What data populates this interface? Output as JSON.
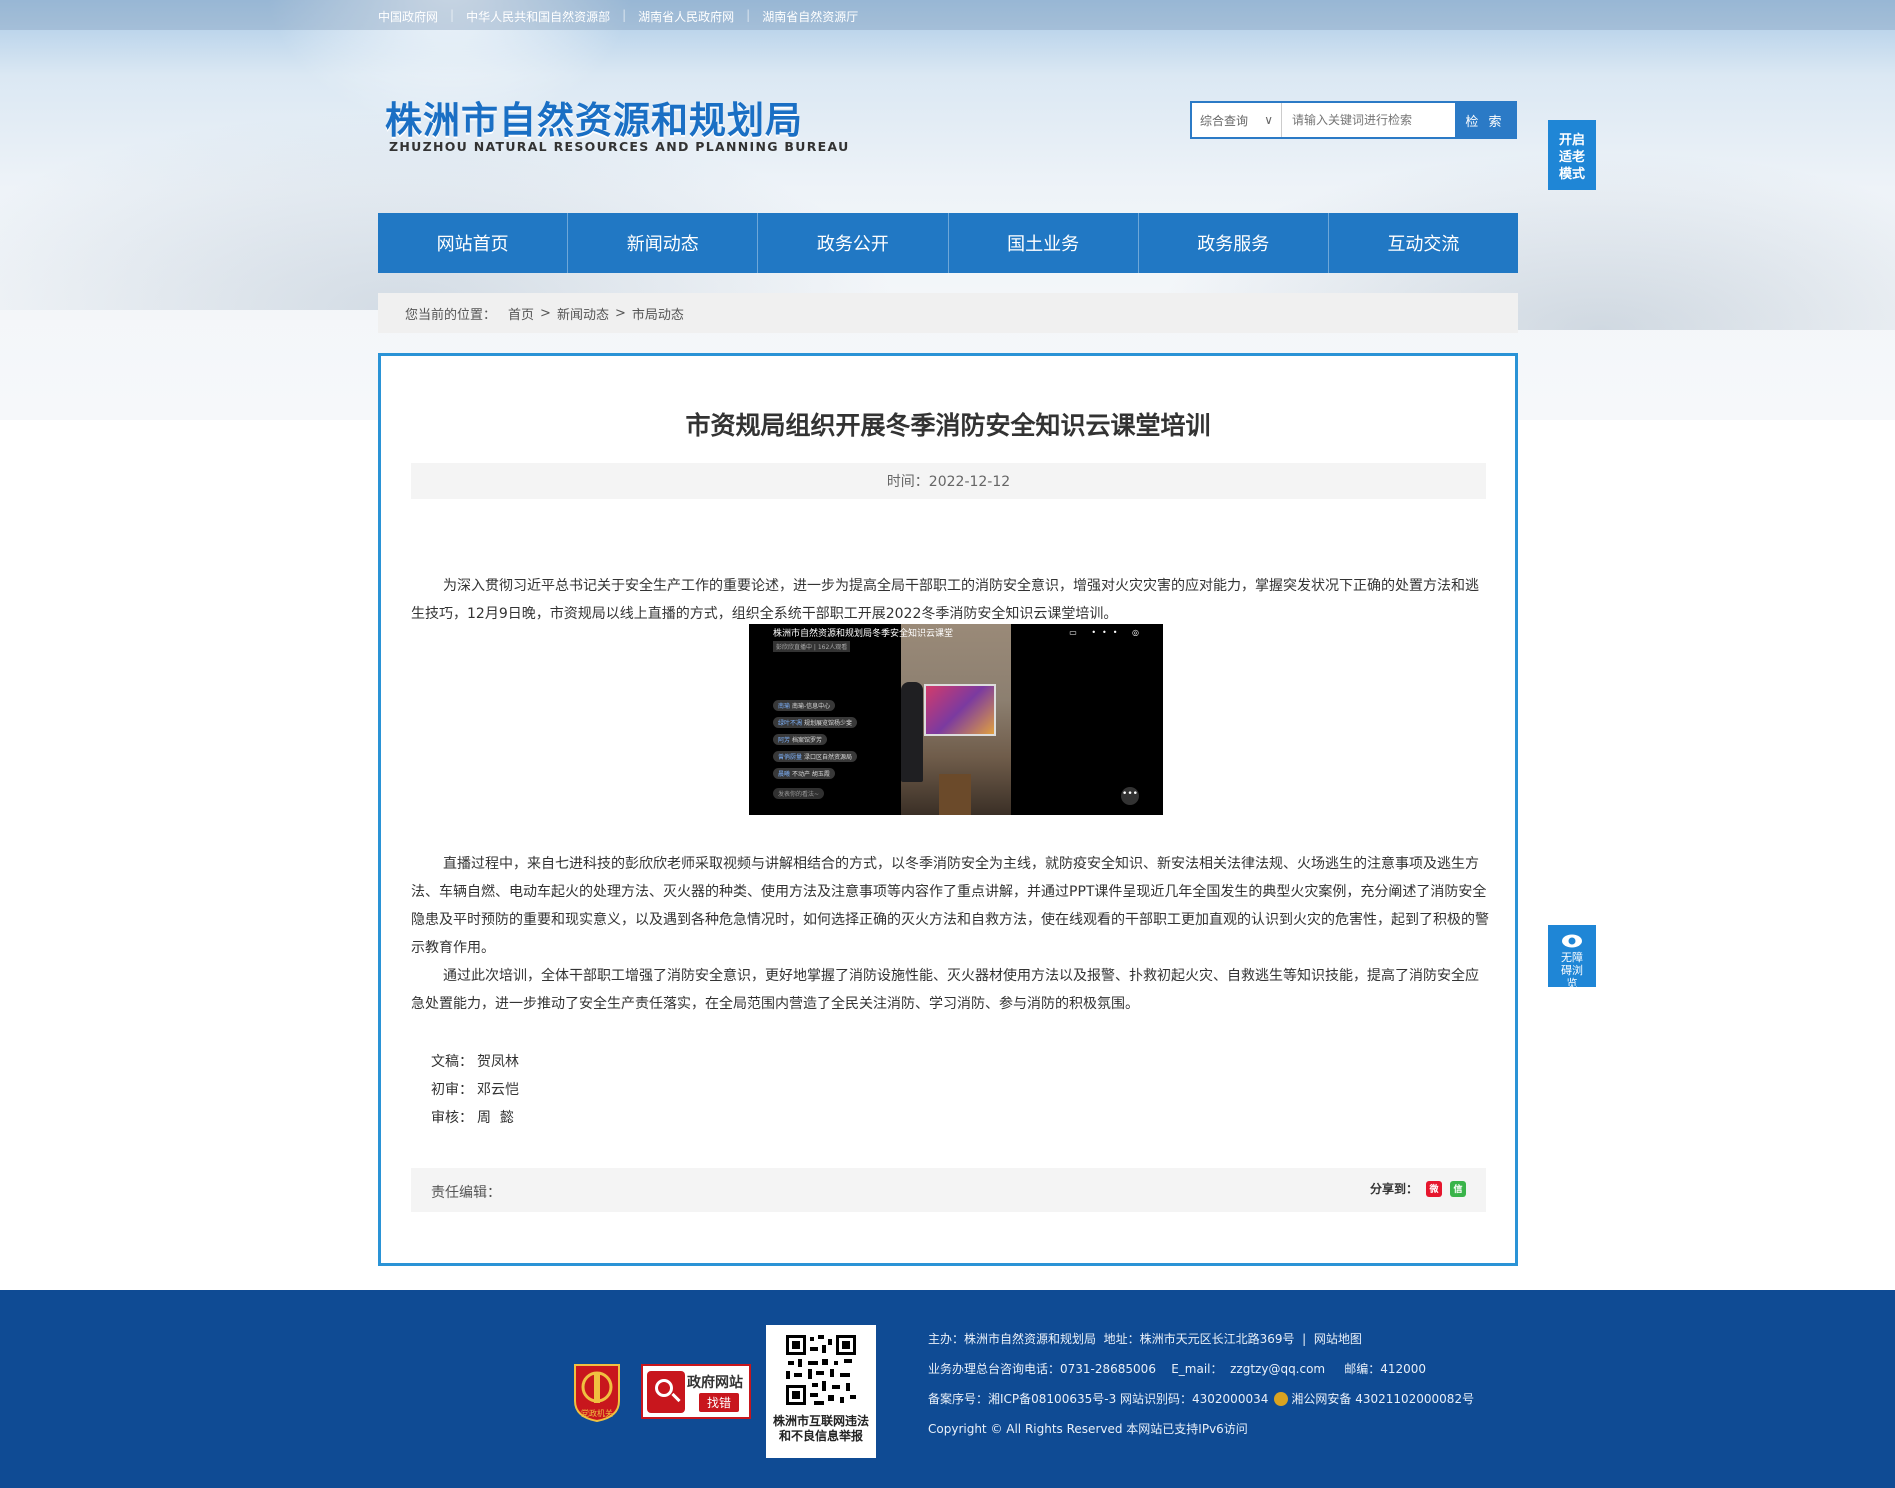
{
  "toplinks": [
    "中国政府网",
    "中华人民共和国自然资源部",
    "湖南省人民政府网",
    "湖南省自然资源厅"
  ],
  "logo": {
    "cn": "株洲市自然资源和规划局",
    "en": "ZHUZHOU NATURAL RESOURCES AND PLANNING BUREAU"
  },
  "search": {
    "select_value": "综合查询",
    "placeholder": "请输入关键词进行检索",
    "button": "检 索"
  },
  "side": {
    "elder_mode": "开启适老模式",
    "accessibility": "无障碍浏览"
  },
  "nav": [
    "网站首页",
    "新闻动态",
    "政务公开",
    "国土业务",
    "政务服务",
    "互动交流"
  ],
  "breadcrumb": {
    "prefix": "您当前的位置：",
    "items": [
      "首页",
      ">",
      "新闻动态",
      ">",
      "市局动态"
    ]
  },
  "article": {
    "title": "市资规局组织开展冬季消防安全知识云课堂培训",
    "date": "时间：2022-12-12",
    "paragraphs": [
      "为深入贯彻习近平总书记关于安全生产工作的重要论述，进一步为提高全局干部职工的消防安全意识，增强对火灾灾害的应对能力，掌握突发状况下正确的处置方法和逃生技巧，12月9日晚，市资规局以线上直播的方式，组织全系统干部职工开展2022冬季消防安全知识云课堂培训。",
      "直播过程中，来自七进科技的彭欣欣老师采取视频与讲解相结合的方式，以冬季消防安全为主线，就防疫安全知识、新安法相关法律法规、火场逃生的注意事项及逃生方法、车辆自燃、电动车起火的处理方法、灭火器的种类、使用方法及注意事项等内容作了重点讲解，并通过PPT课件呈现近几年全国发生的典型火灾案例，充分阐述了消防安全隐患及平时预防的重要和现实意义，以及遇到各种危急情况时，如何选择正确的灭火方法和自救方法，使在线观看的干部职工更加直观的认识到火灾的危害性，起到了积极的警示教育作用。",
      "通过此次培训，全体干部职工增强了消防安全意识，更好地掌握了消防设施性能、灭火器材使用方法以及报警、扑救初起火灾、自救逃生等知识技能，提高了消防安全应急处置能力，进一步推动了安全生产责任落实，在全局范围内营造了全民关注消防、学习消防、参与消防的积极氛围。"
    ],
    "video": {
      "title": "株洲市自然资源和规划局冬季安全知识云课堂",
      "subtitle": "彭欣欣直播中 | 162人观看",
      "comments": [
        {
          "user": "南瑜",
          "text": "南瑜-信息中心"
        },
        {
          "user": "绿叶不凋",
          "text": "规划展览馆杨少斐"
        },
        {
          "user": "阿芳",
          "text": "档案馆罗芳"
        },
        {
          "user": "曾俏厨量",
          "text": "渌口区自然资源局"
        },
        {
          "user": "晨曦",
          "text": "不动产 胡玉霞"
        }
      ],
      "input_placeholder": "发表你的看法~"
    },
    "credits": [
      {
        "label": "文稿：",
        "value": "贺凤林"
      },
      {
        "label": "初审：",
        "value": "邓云恺"
      },
      {
        "label": "审核：",
        "value": "周  懿"
      }
    ],
    "editor_label": "责任编辑：",
    "share_label": "分享到："
  },
  "footer": {
    "party_badge": "党政机关",
    "gov_badge_title": "政府网站",
    "gov_badge_action": "找错",
    "qr_caption_1": "株洲市互联网违法",
    "qr_caption_2": "和不良信息举报",
    "line1": "主办：株洲市自然资源和规划局  地址：株洲市天元区长江北路369号  |  网站地图",
    "line2": "业务办理总台咨询电话：0731-28685006    E_mail：  zzgtzy@qq.com     邮编：412000",
    "line3a": "备案序号：湘ICP备08100635号-3 网站识别码：4302000034",
    "line3b": "湘公网安备 43021102000082号",
    "line4": "Copyright © All Rights Reserved 本网站已支持IPv6访问"
  },
  "colors": {
    "brand_blue": "#2178c4",
    "footer_blue": "#0f4b94",
    "article_border": "#2a93d6"
  }
}
